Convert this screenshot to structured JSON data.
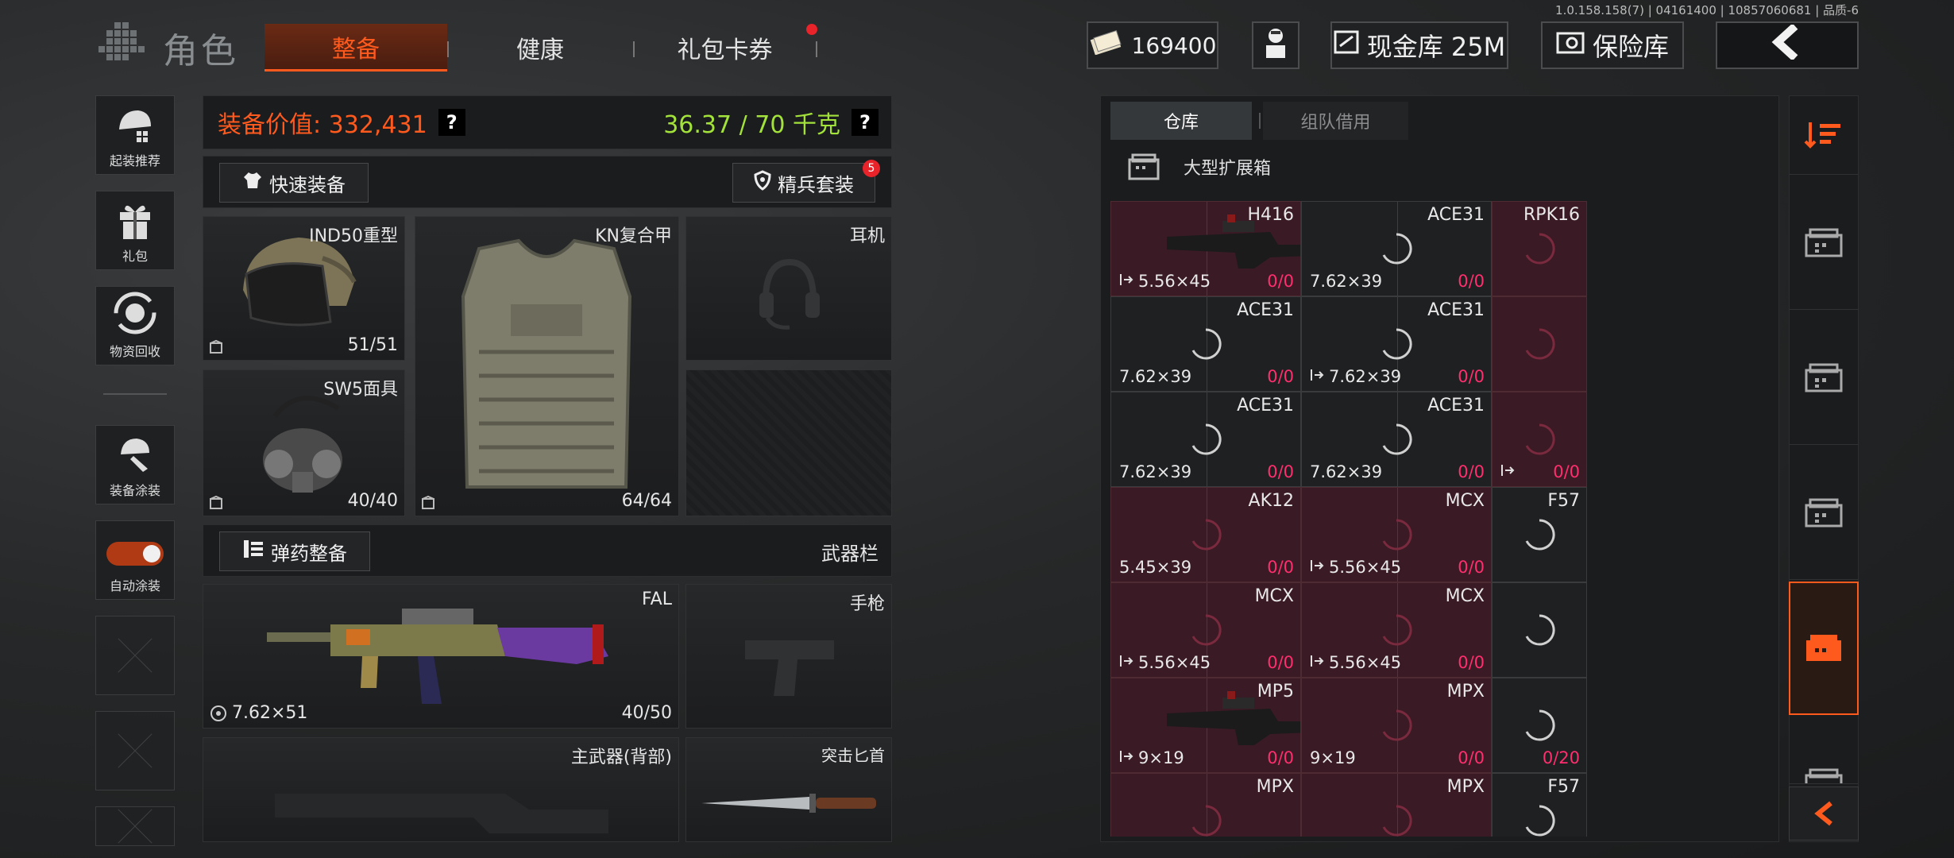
{
  "version": "1.0.158.158(7) | 04161400 | 10857060681 | 品质-6",
  "header": {
    "title": "角色",
    "tabs": [
      {
        "label": "整备",
        "active": true
      },
      {
        "label": "健康",
        "active": false
      },
      {
        "label": "礼包卡券",
        "active": false,
        "has_dot": true
      }
    ],
    "money": "169400",
    "cash_vault": "现金库 25M",
    "safe_vault": "保险库"
  },
  "sidebar": {
    "items": [
      {
        "label": "起装推荐",
        "icon": "helmet-gear-icon"
      },
      {
        "label": "礼包",
        "icon": "gift-icon"
      },
      {
        "label": "物资回收",
        "icon": "recycle-icon"
      },
      {
        "label": "装备涂装",
        "icon": "paint-icon"
      },
      {
        "label": "自动涂装",
        "icon": "toggle-icon",
        "toggle_on": true
      }
    ]
  },
  "equipment": {
    "value_label": "装备价值: 332,431",
    "weight_label": "36.37 / 70 千克",
    "help": "?",
    "quick_equip": "快速装备",
    "elite_suit": "精兵套装",
    "elite_badge": "5",
    "slots": {
      "helmet": {
        "name": "IND50重型",
        "count": "51/51"
      },
      "armor": {
        "name": "KN复合甲",
        "count": "64/64"
      },
      "headset": {
        "name": "耳机"
      },
      "mask": {
        "name": "SW5面具",
        "count": "40/40"
      },
      "ammo_btn": "弹药整备",
      "weapon_bar": "武器栏",
      "primary": {
        "name": "FAL",
        "caliber": "7.62×51",
        "count": "40/50"
      },
      "pistol": {
        "name": "手枪"
      },
      "back": {
        "name": "主武器(背部)"
      },
      "knife": {
        "name": "突击匕首"
      }
    }
  },
  "inventory": {
    "tabs": [
      "仓库",
      "组队借用"
    ],
    "container": "大型扩展箱",
    "rows": [
      [
        {
          "name": "H416",
          "caliber": "5.56×45",
          "amount": "0/0",
          "pink": true,
          "export": true,
          "img": true
        },
        {
          "name": "ACE31",
          "caliber": "7.62×39",
          "amount": "0/0",
          "pink": false
        },
        {
          "name": "RPK16",
          "pink": true,
          "single": true
        }
      ],
      [
        {
          "name": "ACE31",
          "caliber": "7.62×39",
          "amount": "0/0",
          "pink": false
        },
        {
          "name": "ACE31",
          "caliber": "7.62×39",
          "amount": "0/0",
          "pink": false,
          "export": true
        },
        {
          "name": "",
          "pink": true,
          "single": true
        }
      ],
      [
        {
          "name": "ACE31",
          "caliber": "7.62×39",
          "amount": "0/0",
          "pink": false
        },
        {
          "name": "ACE31",
          "caliber": "7.62×39",
          "amount": "0/0",
          "pink": false
        },
        {
          "name": "",
          "amount": "0/0",
          "pink": true,
          "single": true,
          "export": true
        }
      ],
      [
        {
          "name": "AK12",
          "caliber": "5.45×39",
          "amount": "0/0",
          "pink": true
        },
        {
          "name": "MCX",
          "caliber": "5.56×45",
          "amount": "0/0",
          "pink": true,
          "export": true
        },
        {
          "name": "F57",
          "pink": false,
          "single": true
        }
      ],
      [
        {
          "name": "MCX",
          "caliber": "5.56×45",
          "amount": "0/0",
          "pink": true,
          "export": true
        },
        {
          "name": "MCX",
          "caliber": "5.56×45",
          "amount": "0/0",
          "pink": true,
          "export": true
        },
        {
          "name": "",
          "pink": false,
          "single": true
        }
      ],
      [
        {
          "name": "MP5",
          "caliber": "9×19",
          "amount": "0/0",
          "pink": true,
          "export": true,
          "img": true
        },
        {
          "name": "MPX",
          "caliber": "9×19",
          "amount": "0/0",
          "pink": true
        },
        {
          "name": "",
          "amount": "0/20",
          "pink": false,
          "single": true
        }
      ],
      [
        {
          "name": "MPX",
          "pink": true
        },
        {
          "name": "MPX",
          "pink": true
        },
        {
          "name": "F57",
          "pink": false,
          "single": true
        }
      ]
    ]
  },
  "colors": {
    "accent": "#ff5a1e",
    "weight": "#a3e23a",
    "ammo_zero": "#ff2e6e"
  }
}
